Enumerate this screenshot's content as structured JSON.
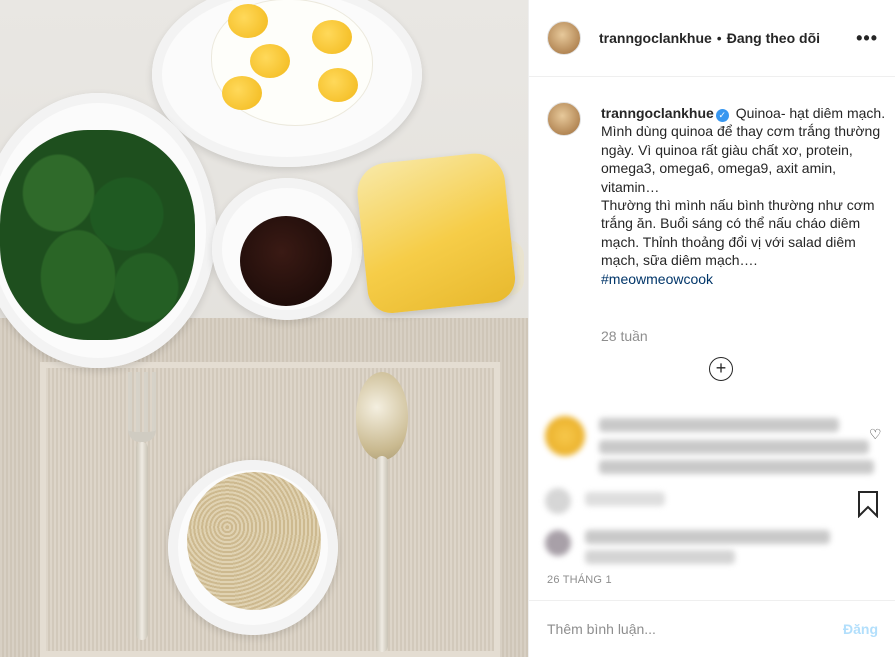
{
  "header": {
    "username": "tranngoclankhue",
    "separator": "•",
    "follow_status": "Đang theo dõi",
    "more_icon": "more-horizontal-icon"
  },
  "caption": {
    "username": "tranngoclankhue",
    "verified_mark": "✓",
    "title": "Quinoa- hạt diêm mạch.",
    "line1": "Mình dùng quinoa để thay cơm trắng thường ngày. Vì quinoa rất giàu chất xơ, protein, omega3, omega6, omega9, axit amin, vitamin…",
    "line2": "Thường thì mình nấu bình thường như cơm trắng ăn. Buổi sáng có thể nấu cháo diêm mạch. Thỉnh thoảng đổi vị với salad diêm mạch, sữa diêm mạch….",
    "hashtag": "#meowmeowcook"
  },
  "time_ago": "28 tuần",
  "load_more_symbol": "+",
  "comment_heart_symbol": "♡",
  "date": "26 THÁNG 1",
  "comment_form": {
    "placeholder": "Thêm bình luận...",
    "post_label": "Đăng"
  },
  "colors": {
    "link": "#003569",
    "verified": "#3897f0",
    "muted": "#8e8e8e",
    "post_disabled": "#b2dffc"
  }
}
